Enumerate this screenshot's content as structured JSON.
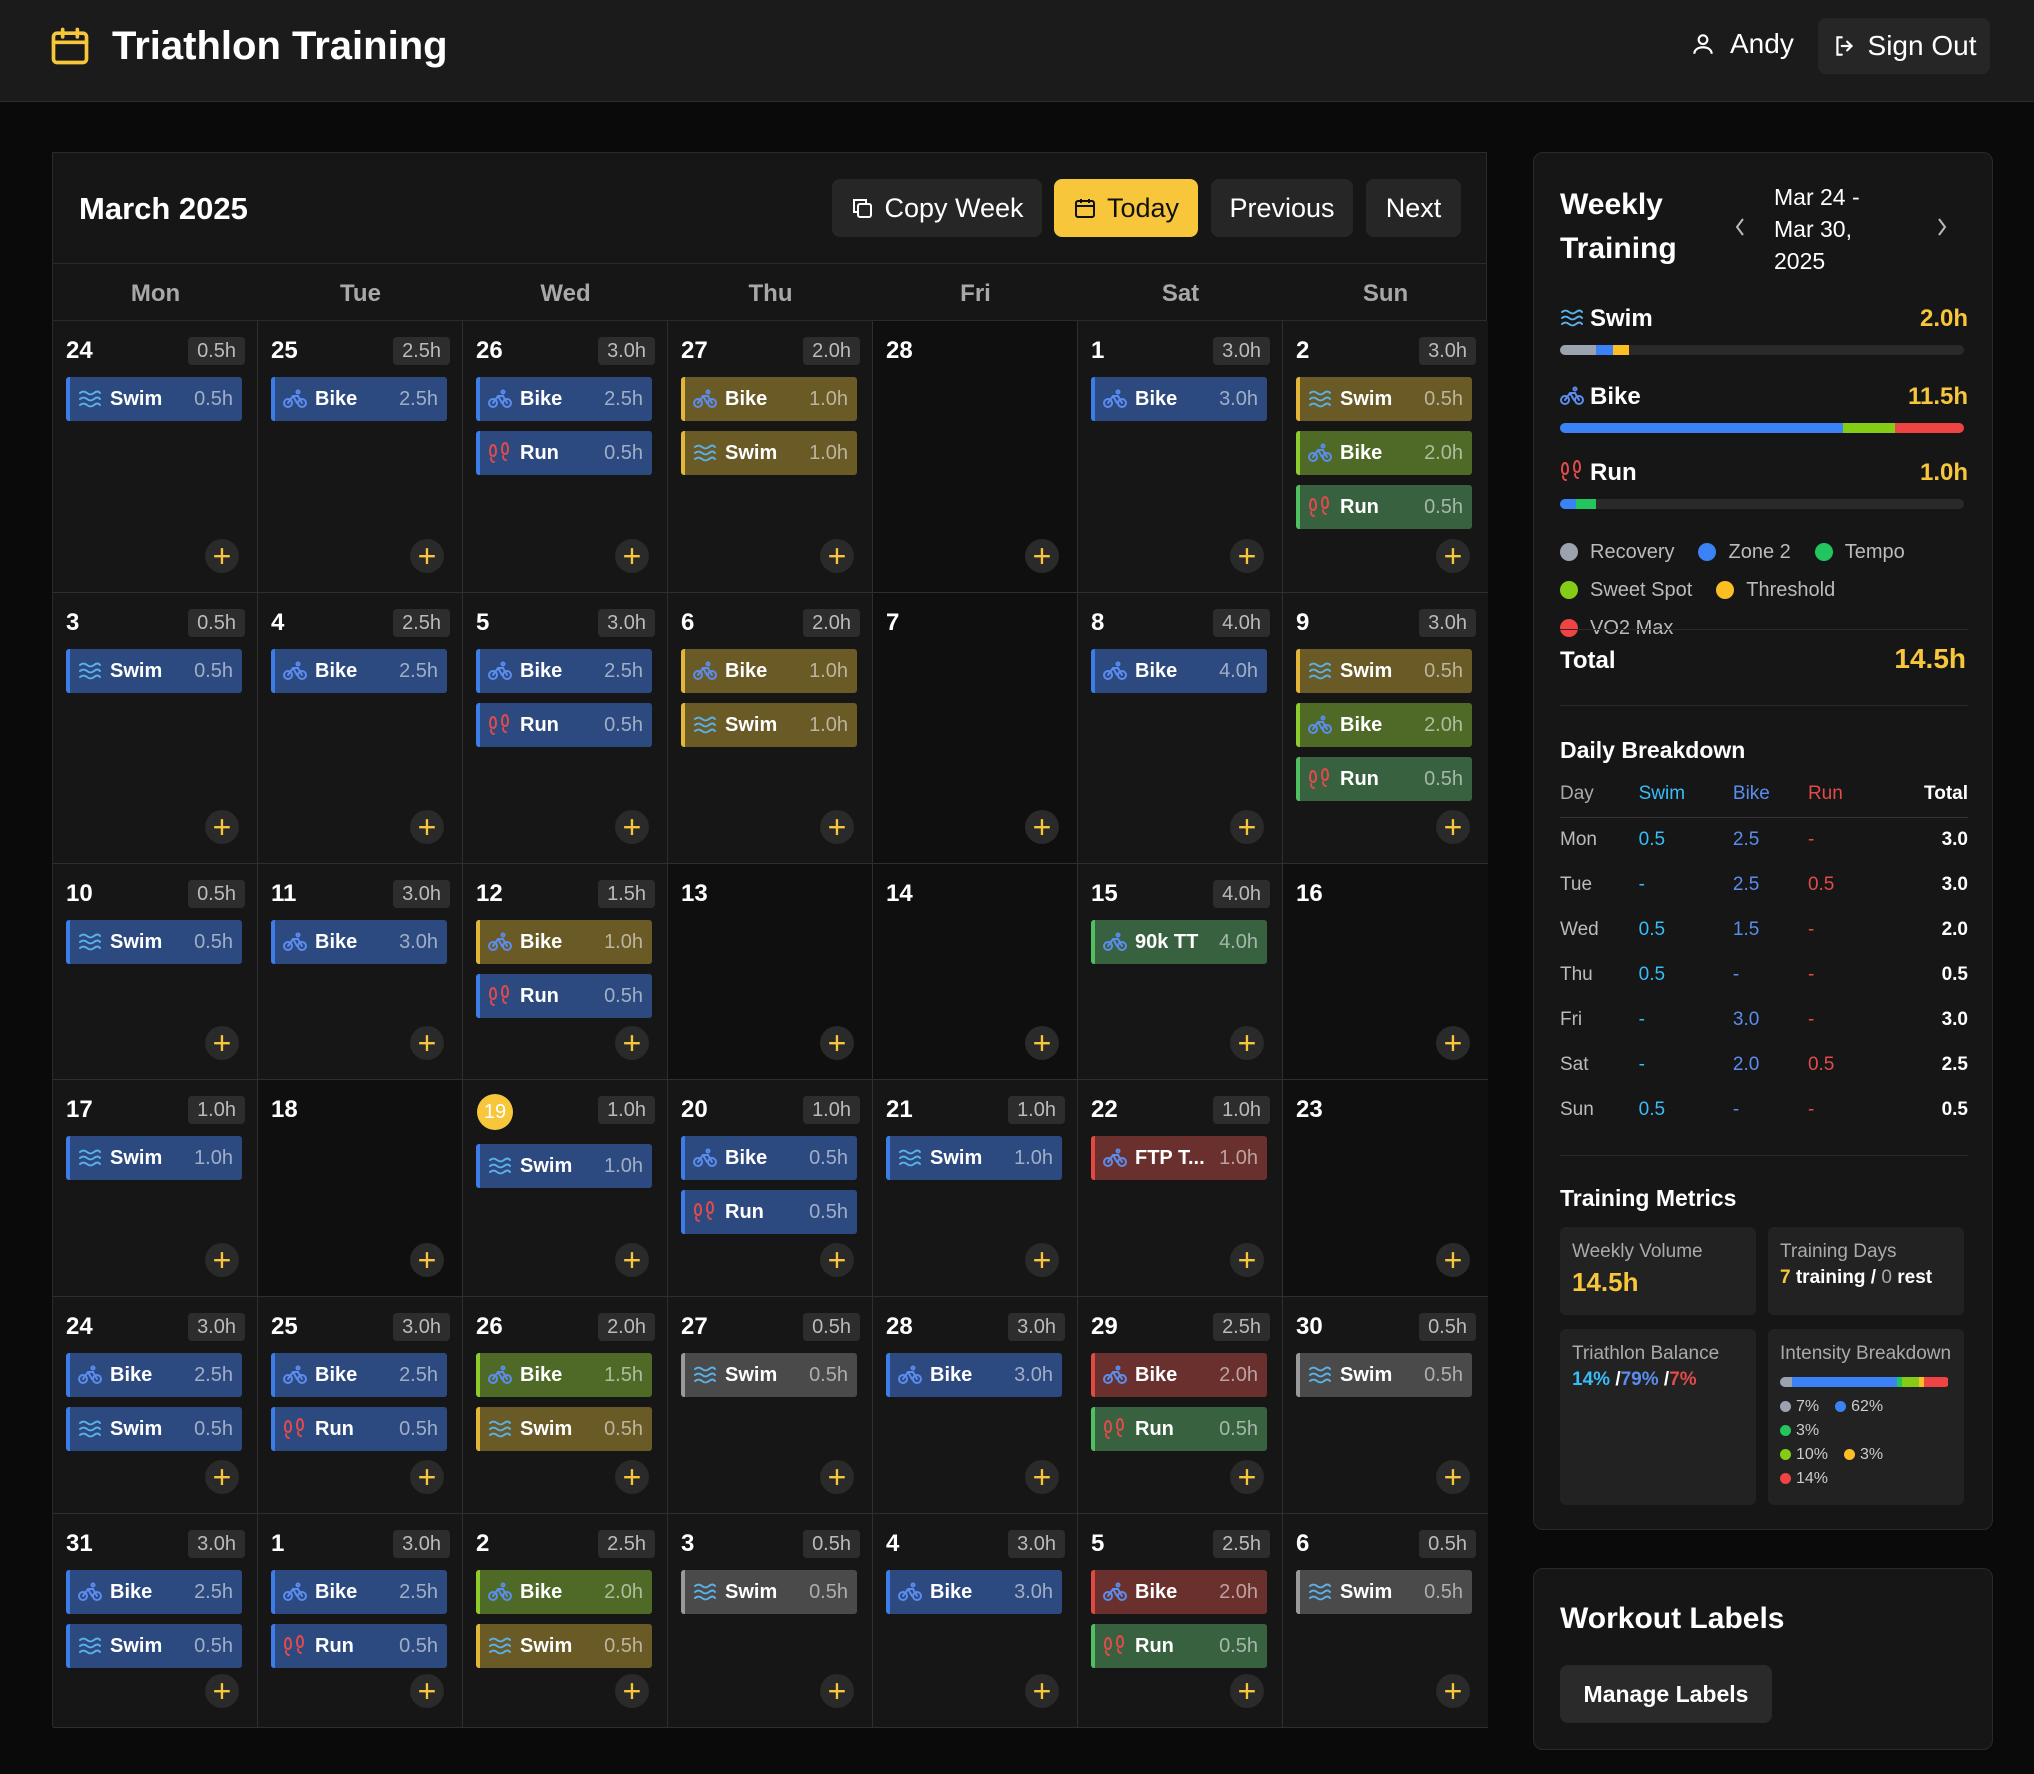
{
  "header": {
    "title": "Triathlon Training",
    "user": "Andy",
    "signout": "Sign Out"
  },
  "calendar": {
    "title": "March 2025",
    "buttons": {
      "copy": "Copy Week",
      "today": "Today",
      "previous": "Previous",
      "next": "Next"
    },
    "days": [
      "Mon",
      "Tue",
      "Wed",
      "Thu",
      "Fri",
      "Sat",
      "Sun"
    ],
    "weeks": [
      [
        {
          "date": "24",
          "total": "0.5h",
          "workouts": [
            {
              "sport": "swim",
              "label": "Swim",
              "dur": "0.5h",
              "color": "blue"
            }
          ]
        },
        {
          "date": "25",
          "total": "2.5h",
          "workouts": [
            {
              "sport": "bike",
              "label": "Bike",
              "dur": "2.5h",
              "color": "blue"
            }
          ]
        },
        {
          "date": "26",
          "total": "3.0h",
          "workouts": [
            {
              "sport": "bike",
              "label": "Bike",
              "dur": "2.5h",
              "color": "blue"
            },
            {
              "sport": "run",
              "label": "Run",
              "dur": "0.5h",
              "color": "blue"
            }
          ]
        },
        {
          "date": "27",
          "total": "2.0h",
          "workouts": [
            {
              "sport": "bike",
              "label": "Bike",
              "dur": "1.0h",
              "color": "yellow"
            },
            {
              "sport": "swim",
              "label": "Swim",
              "dur": "1.0h",
              "color": "yellow"
            }
          ]
        },
        {
          "date": "28",
          "total": "",
          "workouts": []
        },
        {
          "date": "1",
          "total": "3.0h",
          "workouts": [
            {
              "sport": "bike",
              "label": "Bike",
              "dur": "3.0h",
              "color": "blue"
            }
          ]
        },
        {
          "date": "2",
          "total": "3.0h",
          "workouts": [
            {
              "sport": "swim",
              "label": "Swim",
              "dur": "0.5h",
              "color": "yellow"
            },
            {
              "sport": "bike",
              "label": "Bike",
              "dur": "2.0h",
              "color": "lime"
            },
            {
              "sport": "run",
              "label": "Run",
              "dur": "0.5h",
              "color": "green"
            }
          ]
        }
      ],
      [
        {
          "date": "3",
          "total": "0.5h",
          "workouts": [
            {
              "sport": "swim",
              "label": "Swim",
              "dur": "0.5h",
              "color": "blue"
            }
          ]
        },
        {
          "date": "4",
          "total": "2.5h",
          "workouts": [
            {
              "sport": "bike",
              "label": "Bike",
              "dur": "2.5h",
              "color": "blue"
            }
          ]
        },
        {
          "date": "5",
          "total": "3.0h",
          "workouts": [
            {
              "sport": "bike",
              "label": "Bike",
              "dur": "2.5h",
              "color": "blue"
            },
            {
              "sport": "run",
              "label": "Run",
              "dur": "0.5h",
              "color": "blue"
            }
          ]
        },
        {
          "date": "6",
          "total": "2.0h",
          "workouts": [
            {
              "sport": "bike",
              "label": "Bike",
              "dur": "1.0h",
              "color": "yellow"
            },
            {
              "sport": "swim",
              "label": "Swim",
              "dur": "1.0h",
              "color": "yellow"
            }
          ]
        },
        {
          "date": "7",
          "total": "",
          "workouts": []
        },
        {
          "date": "8",
          "total": "4.0h",
          "workouts": [
            {
              "sport": "bike",
              "label": "Bike",
              "dur": "4.0h",
              "color": "blue"
            }
          ]
        },
        {
          "date": "9",
          "total": "3.0h",
          "workouts": [
            {
              "sport": "swim",
              "label": "Swim",
              "dur": "0.5h",
              "color": "yellow"
            },
            {
              "sport": "bike",
              "label": "Bike",
              "dur": "2.0h",
              "color": "lime"
            },
            {
              "sport": "run",
              "label": "Run",
              "dur": "0.5h",
              "color": "green"
            }
          ]
        }
      ],
      [
        {
          "date": "10",
          "total": "0.5h",
          "workouts": [
            {
              "sport": "swim",
              "label": "Swim",
              "dur": "0.5h",
              "color": "blue"
            }
          ]
        },
        {
          "date": "11",
          "total": "3.0h",
          "workouts": [
            {
              "sport": "bike",
              "label": "Bike",
              "dur": "3.0h",
              "color": "blue"
            }
          ]
        },
        {
          "date": "12",
          "total": "1.5h",
          "workouts": [
            {
              "sport": "bike",
              "label": "Bike",
              "dur": "1.0h",
              "color": "yellow"
            },
            {
              "sport": "run",
              "label": "Run",
              "dur": "0.5h",
              "color": "blue"
            }
          ]
        },
        {
          "date": "13",
          "total": "",
          "workouts": []
        },
        {
          "date": "14",
          "total": "",
          "workouts": []
        },
        {
          "date": "15",
          "total": "4.0h",
          "workouts": [
            {
              "sport": "bike",
              "label": "90k TT",
              "dur": "4.0h",
              "color": "green"
            }
          ]
        },
        {
          "date": "16",
          "total": "",
          "workouts": []
        }
      ],
      [
        {
          "date": "17",
          "total": "1.0h",
          "workouts": [
            {
              "sport": "swim",
              "label": "Swim",
              "dur": "1.0h",
              "color": "blue"
            }
          ]
        },
        {
          "date": "18",
          "total": "",
          "workouts": []
        },
        {
          "date": "19",
          "today": true,
          "total": "1.0h",
          "workouts": [
            {
              "sport": "swim",
              "label": "Swim",
              "dur": "1.0h",
              "color": "blue"
            }
          ]
        },
        {
          "date": "20",
          "total": "1.0h",
          "workouts": [
            {
              "sport": "bike",
              "label": "Bike",
              "dur": "0.5h",
              "color": "blue"
            },
            {
              "sport": "run",
              "label": "Run",
              "dur": "0.5h",
              "color": "blue"
            }
          ]
        },
        {
          "date": "21",
          "total": "1.0h",
          "workouts": [
            {
              "sport": "swim",
              "label": "Swim",
              "dur": "1.0h",
              "color": "blue"
            }
          ]
        },
        {
          "date": "22",
          "total": "1.0h",
          "workouts": [
            {
              "sport": "bike",
              "label": "FTP T...",
              "dur": "1.0h",
              "color": "red"
            }
          ]
        },
        {
          "date": "23",
          "total": "",
          "workouts": []
        }
      ],
      [
        {
          "date": "24",
          "total": "3.0h",
          "workouts": [
            {
              "sport": "bike",
              "label": "Bike",
              "dur": "2.5h",
              "color": "blue"
            },
            {
              "sport": "swim",
              "label": "Swim",
              "dur": "0.5h",
              "color": "blue"
            }
          ]
        },
        {
          "date": "25",
          "total": "3.0h",
          "workouts": [
            {
              "sport": "bike",
              "label": "Bike",
              "dur": "2.5h",
              "color": "blue"
            },
            {
              "sport": "run",
              "label": "Run",
              "dur": "0.5h",
              "color": "blue"
            }
          ]
        },
        {
          "date": "26",
          "total": "2.0h",
          "workouts": [
            {
              "sport": "bike",
              "label": "Bike",
              "dur": "1.5h",
              "color": "lime"
            },
            {
              "sport": "swim",
              "label": "Swim",
              "dur": "0.5h",
              "color": "yellow"
            }
          ]
        },
        {
          "date": "27",
          "total": "0.5h",
          "workouts": [
            {
              "sport": "swim",
              "label": "Swim",
              "dur": "0.5h",
              "color": "gray"
            }
          ]
        },
        {
          "date": "28",
          "total": "3.0h",
          "workouts": [
            {
              "sport": "bike",
              "label": "Bike",
              "dur": "3.0h",
              "color": "blue"
            }
          ]
        },
        {
          "date": "29",
          "total": "2.5h",
          "workouts": [
            {
              "sport": "bike",
              "label": "Bike",
              "dur": "2.0h",
              "color": "red"
            },
            {
              "sport": "run",
              "label": "Run",
              "dur": "0.5h",
              "color": "green"
            }
          ]
        },
        {
          "date": "30",
          "total": "0.5h",
          "workouts": [
            {
              "sport": "swim",
              "label": "Swim",
              "dur": "0.5h",
              "color": "gray"
            }
          ]
        }
      ],
      [
        {
          "date": "31",
          "total": "3.0h",
          "workouts": [
            {
              "sport": "bike",
              "label": "Bike",
              "dur": "2.5h",
              "color": "blue"
            },
            {
              "sport": "swim",
              "label": "Swim",
              "dur": "0.5h",
              "color": "blue"
            }
          ]
        },
        {
          "date": "1",
          "total": "3.0h",
          "workouts": [
            {
              "sport": "bike",
              "label": "Bike",
              "dur": "2.5h",
              "color": "blue"
            },
            {
              "sport": "run",
              "label": "Run",
              "dur": "0.5h",
              "color": "blue"
            }
          ]
        },
        {
          "date": "2",
          "total": "2.5h",
          "workouts": [
            {
              "sport": "bike",
              "label": "Bike",
              "dur": "2.0h",
              "color": "lime"
            },
            {
              "sport": "swim",
              "label": "Swim",
              "dur": "0.5h",
              "color": "yellow"
            }
          ]
        },
        {
          "date": "3",
          "total": "0.5h",
          "workouts": [
            {
              "sport": "swim",
              "label": "Swim",
              "dur": "0.5h",
              "color": "gray"
            }
          ]
        },
        {
          "date": "4",
          "total": "3.0h",
          "workouts": [
            {
              "sport": "bike",
              "label": "Bike",
              "dur": "3.0h",
              "color": "blue"
            }
          ]
        },
        {
          "date": "5",
          "total": "2.5h",
          "workouts": [
            {
              "sport": "bike",
              "label": "Bike",
              "dur": "2.0h",
              "color": "red"
            },
            {
              "sport": "run",
              "label": "Run",
              "dur": "0.5h",
              "color": "green"
            }
          ]
        },
        {
          "date": "6",
          "total": "0.5h",
          "workouts": [
            {
              "sport": "swim",
              "label": "Swim",
              "dur": "0.5h",
              "color": "gray"
            }
          ]
        }
      ]
    ]
  },
  "weekly": {
    "title": "Weekly Training",
    "range": "Mar 24 - Mar 30, 2025",
    "sports": [
      {
        "name": "Swim",
        "hours": "2.0h",
        "segments": [
          {
            "color": "#9ca3af",
            "pct": 0.09
          },
          {
            "color": "#3b82f6",
            "pct": 0.04
          },
          {
            "color": "#fbbf24",
            "pct": 0.04
          }
        ]
      },
      {
        "name": "Bike",
        "hours": "11.5h",
        "segments": [
          {
            "color": "#3b82f6",
            "pct": 0.7
          },
          {
            "color": "#84cc16",
            "pct": 0.13
          },
          {
            "color": "#ef4444",
            "pct": 0.17
          }
        ]
      },
      {
        "name": "Run",
        "hours": "1.0h",
        "segments": [
          {
            "color": "#3b82f6",
            "pct": 0.04
          },
          {
            "color": "#22c55e",
            "pct": 0.05
          }
        ]
      }
    ],
    "legend": [
      {
        "label": "Recovery",
        "color": "#9ca3af"
      },
      {
        "label": "Zone 2",
        "color": "#3b82f6"
      },
      {
        "label": "Tempo",
        "color": "#22c55e"
      },
      {
        "label": "Sweet Spot",
        "color": "#84cc16"
      },
      {
        "label": "Threshold",
        "color": "#fbbf24"
      },
      {
        "label": "VO2 Max",
        "color": "#ef4444"
      }
    ],
    "total_label": "Total",
    "total": "14.5h",
    "daily_title": "Daily Breakdown",
    "daily_headers": [
      "Day",
      "Swim",
      "Bike",
      "Run",
      "Total"
    ],
    "daily": [
      [
        "Mon",
        "0.5",
        "2.5",
        "-",
        "3.0"
      ],
      [
        "Tue",
        "-",
        "2.5",
        "0.5",
        "3.0"
      ],
      [
        "Wed",
        "0.5",
        "1.5",
        "-",
        "2.0"
      ],
      [
        "Thu",
        "0.5",
        "-",
        "-",
        "0.5"
      ],
      [
        "Fri",
        "-",
        "3.0",
        "-",
        "3.0"
      ],
      [
        "Sat",
        "-",
        "2.0",
        "0.5",
        "2.5"
      ],
      [
        "Sun",
        "0.5",
        "-",
        "-",
        "0.5"
      ]
    ],
    "metrics_title": "Training Metrics",
    "volume_label": "Weekly Volume",
    "volume": "14.5h",
    "days_label": "Training Days",
    "training_days": "7",
    "training_word": "training /",
    "rest_days": "0",
    "rest_word": "rest",
    "balance_label": "Triathlon Balance",
    "balance": {
      "swim": "14%",
      "bike": "79%",
      "run": "7%",
      "sep": "/"
    },
    "intensity_label": "Intensity Breakdown",
    "intensity": [
      {
        "pct": "7%",
        "value": 7,
        "color": "#9ca3af"
      },
      {
        "pct": "62%",
        "value": 62,
        "color": "#3b82f6"
      },
      {
        "pct": "3%",
        "value": 3,
        "color": "#22c55e"
      },
      {
        "pct": "10%",
        "value": 10,
        "color": "#84cc16"
      },
      {
        "pct": "3%",
        "value": 3,
        "color": "#fbbf24"
      },
      {
        "pct": "14%",
        "value": 14,
        "color": "#ef4444"
      }
    ]
  },
  "labels": {
    "title": "Workout Labels",
    "manage": "Manage Labels"
  }
}
